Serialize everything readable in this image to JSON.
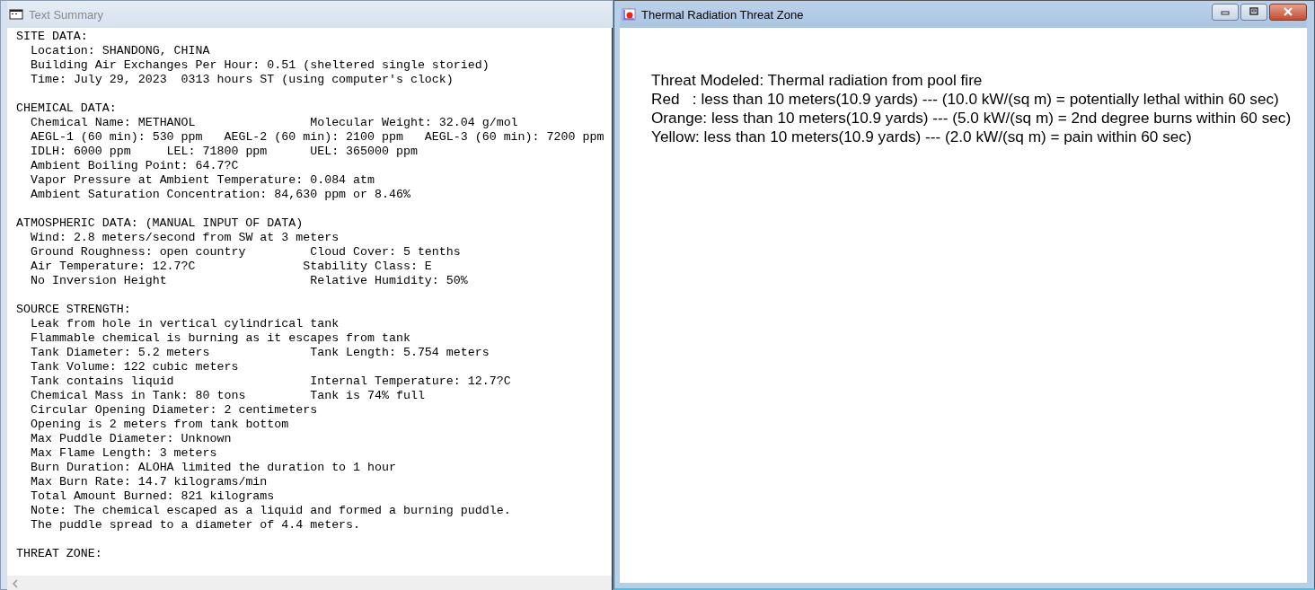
{
  "summary_window": {
    "title": "Text Summary",
    "active": false,
    "sections": [
      {
        "heading": "SITE DATA:",
        "lines": [
          "Location: SHANDONG, CHINA",
          "Building Air Exchanges Per Hour: 0.51 (sheltered single storied)",
          "Time: July 29, 2023  0313 hours ST (using computer's clock)"
        ]
      },
      {
        "heading": "CHEMICAL DATA:",
        "lines": [
          "Chemical Name: METHANOL                Molecular Weight: 32.04 g/mol",
          "AEGL-1 (60 min): 530 ppm   AEGL-2 (60 min): 2100 ppm   AEGL-3 (60 min): 7200 ppm",
          "IDLH: 6000 ppm     LEL: 71800 ppm      UEL: 365000 ppm",
          "Ambient Boiling Point: 64.7?C",
          "Vapor Pressure at Ambient Temperature: 0.084 atm",
          "Ambient Saturation Concentration: 84,630 ppm or 8.46%"
        ]
      },
      {
        "heading": "ATMOSPHERIC DATA: (MANUAL INPUT OF DATA)",
        "lines": [
          "Wind: 2.8 meters/second from SW at 3 meters",
          "Ground Roughness: open country         Cloud Cover: 5 tenths",
          "Air Temperature: 12.7?C               Stability Class: E",
          "No Inversion Height                    Relative Humidity: 50%"
        ]
      },
      {
        "heading": "SOURCE STRENGTH:",
        "lines": [
          "Leak from hole in vertical cylindrical tank",
          "Flammable chemical is burning as it escapes from tank",
          "Tank Diameter: 5.2 meters              Tank Length: 5.754 meters",
          "Tank Volume: 122 cubic meters",
          "Tank contains liquid                   Internal Temperature: 12.7?C",
          "Chemical Mass in Tank: 80 tons         Tank is 74% full",
          "Circular Opening Diameter: 2 centimeters",
          "Opening is 2 meters from tank bottom",
          "Max Puddle Diameter: Unknown",
          "Max Flame Length: 3 meters",
          "Burn Duration: ALOHA limited the duration to 1 hour",
          "Max Burn Rate: 14.7 kilograms/min",
          "Total Amount Burned: 821 kilograms",
          "Note: The chemical escaped as a liquid and formed a burning puddle.",
          "The puddle spread to a diameter of 4.4 meters."
        ]
      },
      {
        "heading": "THREAT ZONE:"
      }
    ]
  },
  "threat_window": {
    "title": "Thermal Radiation Threat Zone",
    "active": true,
    "lines": [
      "Threat Modeled: Thermal radiation from pool fire",
      "Red   : less than 10 meters(10.9 yards) --- (10.0 kW/(sq m) = potentially lethal within 60 sec)",
      "Orange: less than 10 meters(10.9 yards) --- (5.0 kW/(sq m) = 2nd degree burns within 60 sec)",
      "Yellow: less than 10 meters(10.9 yards) --- (2.0 kW/(sq m) = pain within 60 sec)"
    ]
  }
}
